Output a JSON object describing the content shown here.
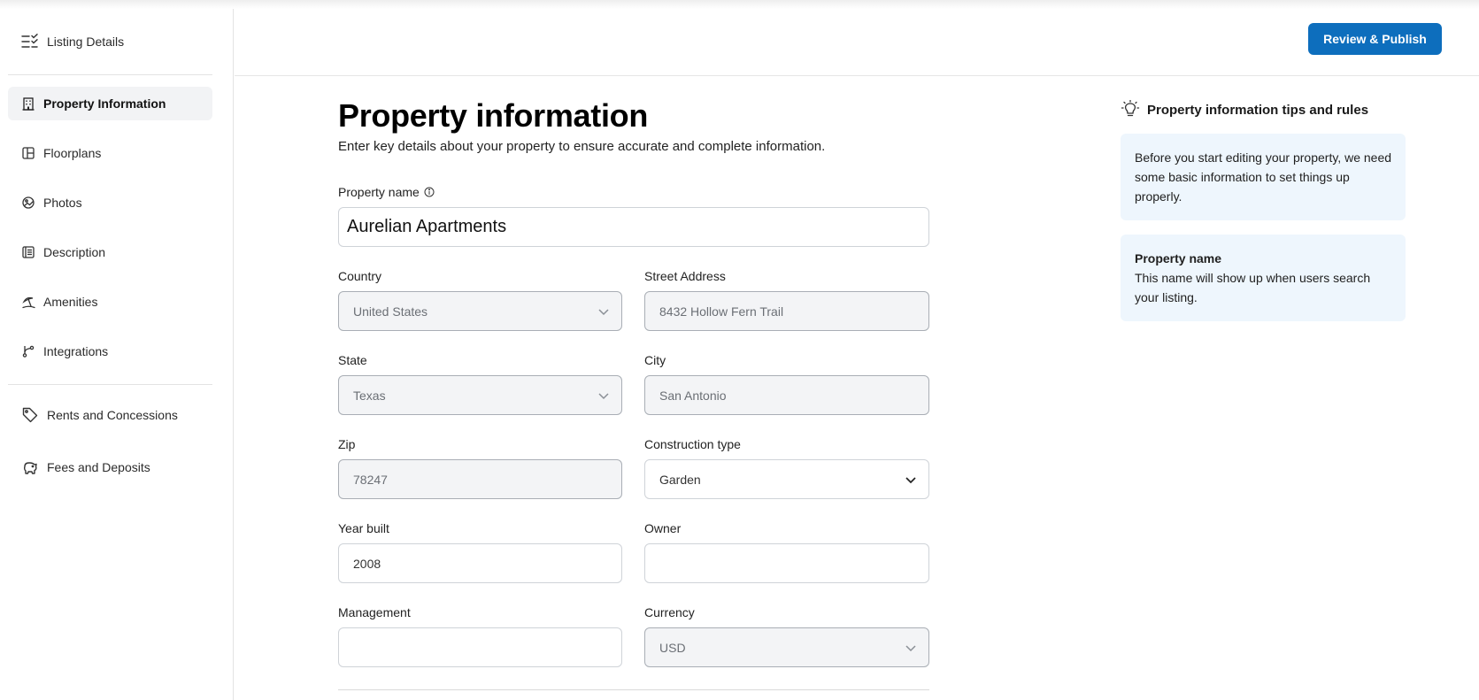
{
  "sidebar": {
    "listing_details": "Listing Details",
    "items": [
      {
        "label": "Property Information",
        "icon": "building-icon"
      },
      {
        "label": "Floorplans",
        "icon": "floorplan-icon"
      },
      {
        "label": "Photos",
        "icon": "photo-icon"
      },
      {
        "label": "Description",
        "icon": "document-icon"
      },
      {
        "label": "Amenities",
        "icon": "beach-umbrella-icon"
      },
      {
        "label": "Integrations",
        "icon": "branch-icon"
      }
    ],
    "secondary": [
      {
        "label": "Rents and Concessions",
        "icon": "tag-icon"
      },
      {
        "label": "Fees and Deposits",
        "icon": "piggy-bank-icon"
      }
    ]
  },
  "header": {
    "publish_label": "Review & Publish"
  },
  "main": {
    "title": "Property information",
    "subtitle": "Enter key details about your property to ensure accurate and complete information.",
    "fields": {
      "property_name": {
        "label": "Property name",
        "value": "Aurelian Apartments"
      },
      "country": {
        "label": "Country",
        "value": "United States"
      },
      "street": {
        "label": "Street Address",
        "value": "8432 Hollow Fern Trail"
      },
      "state": {
        "label": "State",
        "value": "Texas"
      },
      "city": {
        "label": "City",
        "value": "San Antonio"
      },
      "zip": {
        "label": "Zip",
        "value": "78247"
      },
      "construction": {
        "label": "Construction type",
        "value": "Garden"
      },
      "year_built": {
        "label": "Year built",
        "value": "2008"
      },
      "owner": {
        "label": "Owner",
        "value": ""
      },
      "management": {
        "label": "Management",
        "value": ""
      },
      "currency": {
        "label": "Currency",
        "value": "USD"
      }
    }
  },
  "tips": {
    "title": "Property information tips and rules",
    "card1": "Before you start editing your property, we need some basic information to set things up properly.",
    "card2_head": "Property name",
    "card2_body": "This name will show up when users search your listing."
  },
  "colors": {
    "accent": "#0d6ebd",
    "tip_bg": "#eef6fd",
    "active_nav_bg": "#f2f3f5"
  }
}
